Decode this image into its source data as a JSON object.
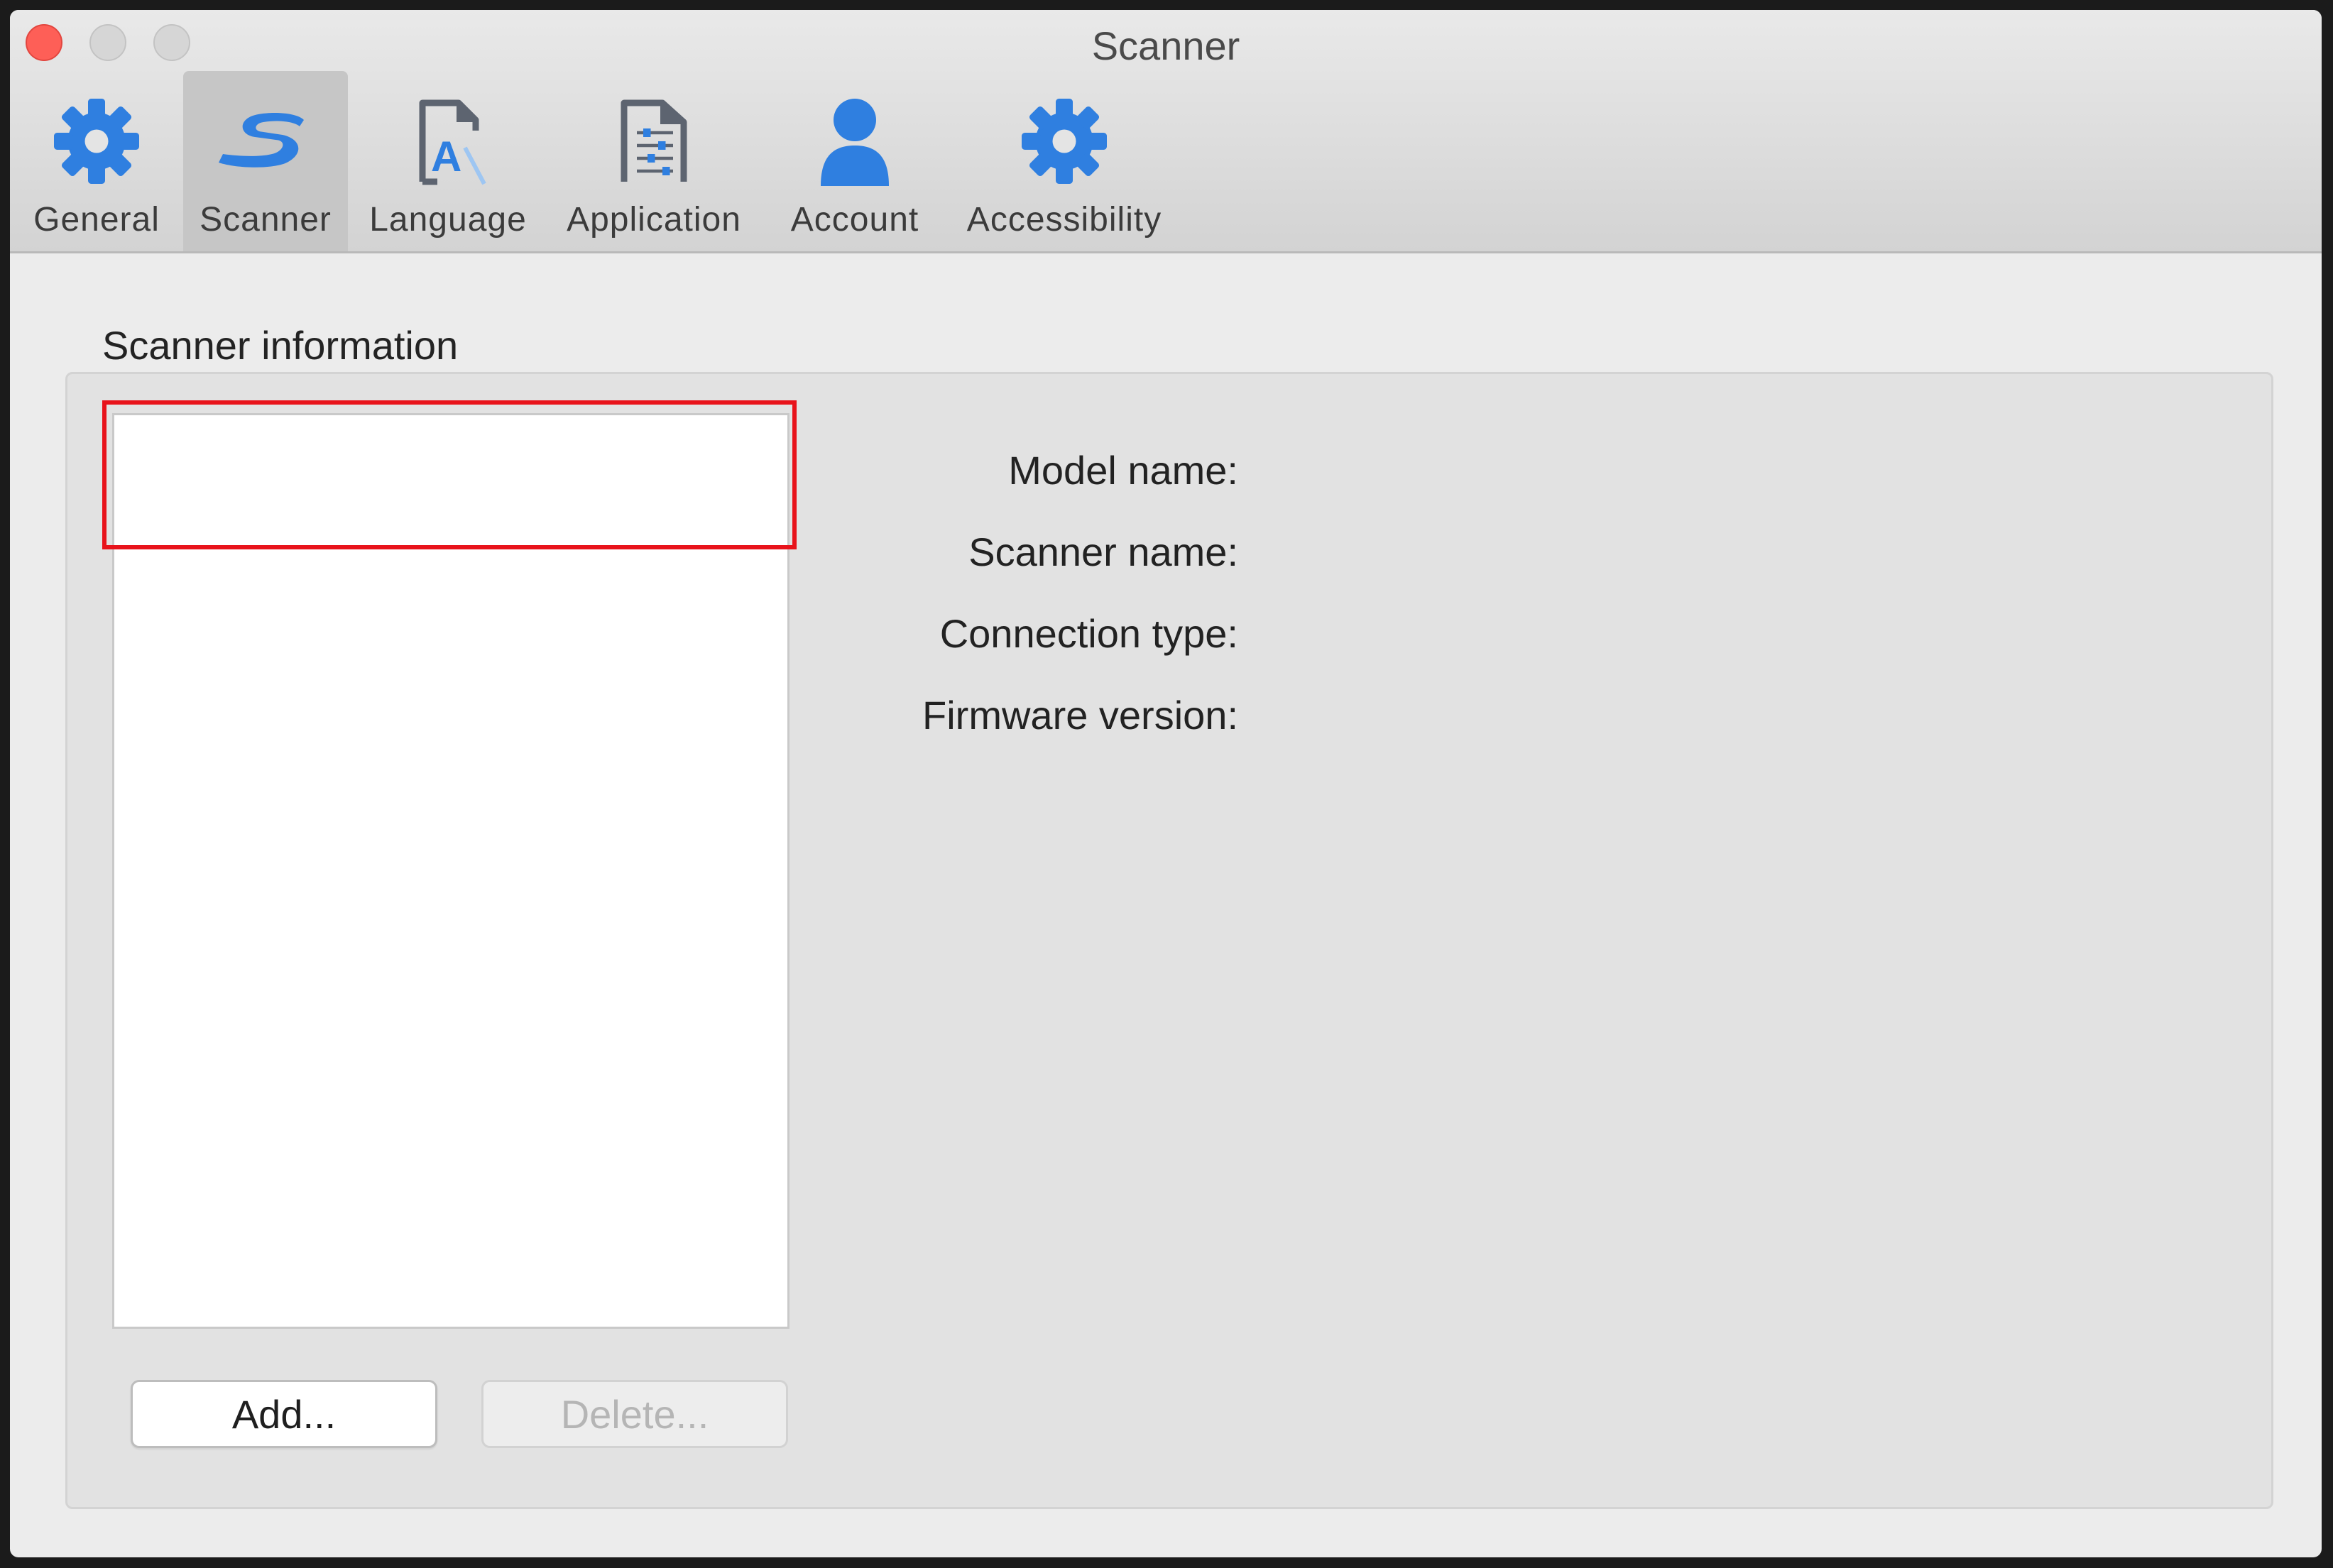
{
  "window": {
    "title": "Scanner"
  },
  "toolbar": {
    "tabs": [
      {
        "label": "General",
        "icon": "gear-icon"
      },
      {
        "label": "Scanner",
        "icon": "scanner-s-logo-icon"
      },
      {
        "label": "Language",
        "icon": "document-letter-a-icon"
      },
      {
        "label": "Application",
        "icon": "document-sliders-icon"
      },
      {
        "label": "Account",
        "icon": "person-icon"
      },
      {
        "label": "Accessibility",
        "icon": "gear-icon"
      }
    ],
    "selected_tab": "Scanner",
    "icon_color": "#2f7fe0"
  },
  "scanner_info": {
    "section_title": "Scanner information",
    "list_items": [],
    "labels": {
      "model_name": "Model name:",
      "scanner_name": "Scanner name:",
      "connection_type": "Connection type:",
      "firmware_version": "Firmware version:"
    },
    "buttons": {
      "add": "Add...",
      "delete": "Delete..."
    }
  },
  "highlight_color": "#e8131b"
}
